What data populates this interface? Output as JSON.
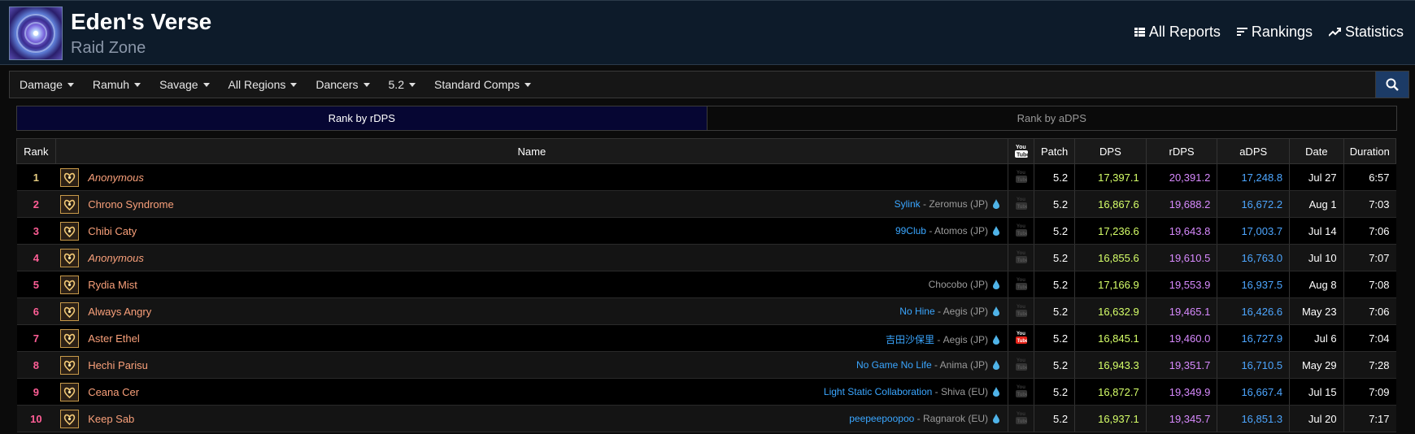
{
  "header": {
    "title": "Eden's Verse",
    "subtitle": "Raid Zone",
    "nav": [
      {
        "label": "All Reports",
        "icon": "table-icon"
      },
      {
        "label": "Rankings",
        "icon": "list-icon"
      },
      {
        "label": "Statistics",
        "icon": "trend-icon"
      }
    ]
  },
  "filters": [
    "Damage",
    "Ramuh",
    "Savage",
    "All Regions",
    "Dancers",
    "5.2",
    "Standard Comps"
  ],
  "tabs": {
    "rdps": "Rank by rDPS",
    "adps": "Rank by aDPS"
  },
  "table": {
    "headers": {
      "rank": "Rank",
      "name": "Name",
      "patch": "Patch",
      "dps": "DPS",
      "rdps": "rDPS",
      "adps": "aDPS",
      "date": "Date",
      "duration": "Duration"
    },
    "rows": [
      {
        "rank": "1",
        "name": "Anonymous",
        "anon": true,
        "guild": "",
        "server": "",
        "patch": "5.2",
        "dps": "17,397.1",
        "rdps": "20,391.2",
        "adps": "17,248.8",
        "date": "Jul 27",
        "duration": "6:57",
        "video": false
      },
      {
        "rank": "2",
        "name": "Chrono Syndrome",
        "anon": false,
        "guild": "Sylink",
        "server": "Zeromus (JP)",
        "patch": "5.2",
        "dps": "16,867.6",
        "rdps": "19,688.2",
        "adps": "16,672.2",
        "date": "Aug 1",
        "duration": "7:03",
        "video": false
      },
      {
        "rank": "3",
        "name": "Chibi Caty",
        "anon": false,
        "guild": "99Club",
        "server": "Atomos (JP)",
        "patch": "5.2",
        "dps": "17,236.6",
        "rdps": "19,643.8",
        "adps": "17,003.7",
        "date": "Jul 14",
        "duration": "7:06",
        "video": false
      },
      {
        "rank": "4",
        "name": "Anonymous",
        "anon": true,
        "guild": "",
        "server": "",
        "patch": "5.2",
        "dps": "16,855.6",
        "rdps": "19,610.5",
        "adps": "16,763.0",
        "date": "Jul 10",
        "duration": "7:07",
        "video": false
      },
      {
        "rank": "5",
        "name": "Rydia Mist",
        "anon": false,
        "guild": "",
        "server": "Chocobo (JP)",
        "patch": "5.2",
        "dps": "17,166.9",
        "rdps": "19,553.9",
        "adps": "16,937.5",
        "date": "Aug 8",
        "duration": "7:08",
        "video": false
      },
      {
        "rank": "6",
        "name": "Always Angry",
        "anon": false,
        "guild": "No Hine",
        "server": "Aegis (JP)",
        "patch": "5.2",
        "dps": "16,632.9",
        "rdps": "19,465.1",
        "adps": "16,426.6",
        "date": "May 23",
        "duration": "7:06",
        "video": false
      },
      {
        "rank": "7",
        "name": "Aster Ethel",
        "anon": false,
        "guild": "吉田沙保里",
        "server": "Aegis (JP)",
        "patch": "5.2",
        "dps": "16,845.1",
        "rdps": "19,460.0",
        "adps": "16,727.9",
        "date": "Jul 6",
        "duration": "7:04",
        "video": true
      },
      {
        "rank": "8",
        "name": "Hechi Parisu",
        "anon": false,
        "guild": "No Game No Life",
        "server": "Anima (JP)",
        "patch": "5.2",
        "dps": "16,943.3",
        "rdps": "19,351.7",
        "adps": "16,710.5",
        "date": "May 29",
        "duration": "7:28",
        "video": false
      },
      {
        "rank": "9",
        "name": "Ceana Cer",
        "anon": false,
        "guild": "Light Static Collaboration",
        "server": "Shiva (EU)",
        "patch": "5.2",
        "dps": "16,872.7",
        "rdps": "19,349.9",
        "adps": "16,667.4",
        "date": "Jul 15",
        "duration": "7:09",
        "video": false
      },
      {
        "rank": "10",
        "name": "Keep Sab",
        "anon": false,
        "guild": "peepeepoopoo",
        "server": "Ragnarok (EU)",
        "patch": "5.2",
        "dps": "16,937.1",
        "rdps": "19,345.7",
        "adps": "16,851.3",
        "date": "Jul 20",
        "duration": "7:17",
        "video": false
      }
    ]
  },
  "colors": {
    "rank_first": "#e5cc80",
    "rank_other": "#ff5e96",
    "dps": "#d6ff69",
    "rdps": "#d88aff",
    "adps": "#4da6ff",
    "name": "#f9a07a",
    "guild": "#3aa6ff"
  }
}
